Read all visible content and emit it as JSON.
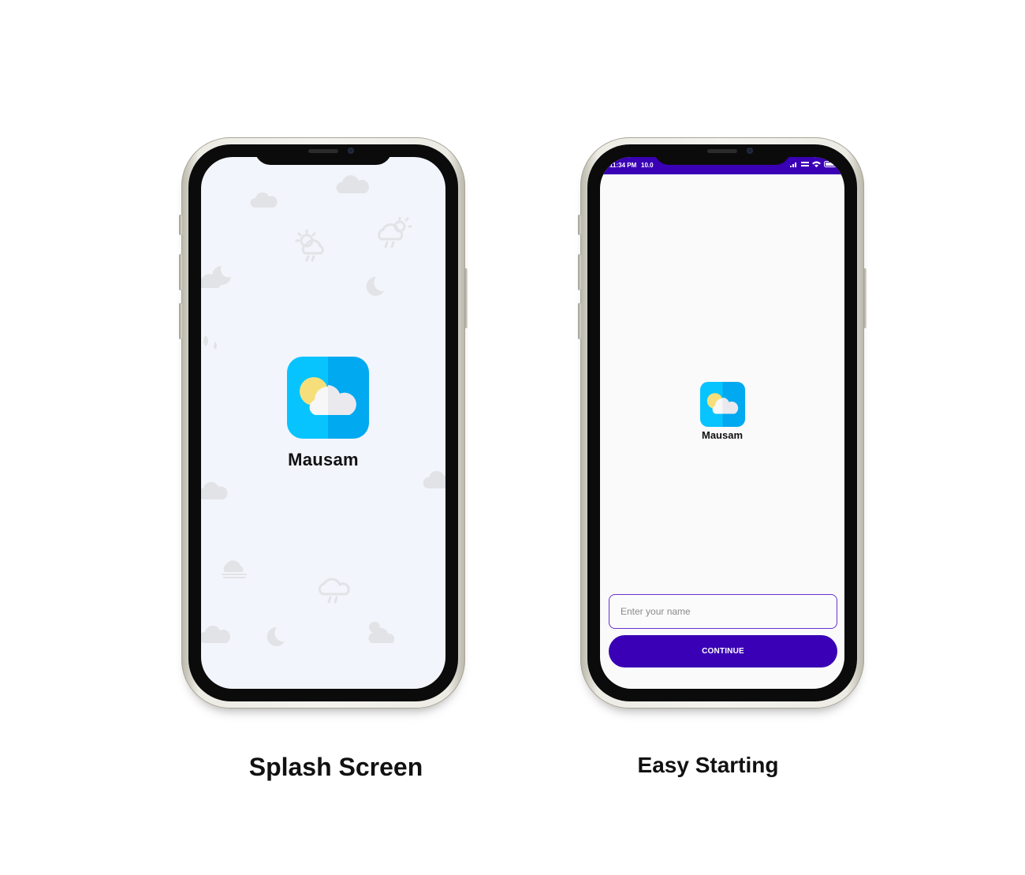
{
  "splash": {
    "app_name": "Mausam",
    "caption": "Splash Screen"
  },
  "start": {
    "status_time": "11:34 PM",
    "status_extra": "10.0",
    "app_name": "Mausam",
    "name_placeholder": "Enter your name",
    "continue_label": "CONTINUE",
    "caption": "Easy Starting"
  },
  "colors": {
    "primary": "#3a00b5",
    "logo_left": "#07c4ff",
    "logo_right": "#00a9f0",
    "sun": "#f6df7a",
    "splash_bg": "#f2f5fb"
  },
  "icons": {
    "logo": "sun-cloud-icon",
    "decorations": [
      "cloud-icon",
      "sun-rain-cloud-icon",
      "moon-icon",
      "moon-cloud-icon",
      "rain-cloud-icon",
      "sun-cloud-icon"
    ]
  }
}
